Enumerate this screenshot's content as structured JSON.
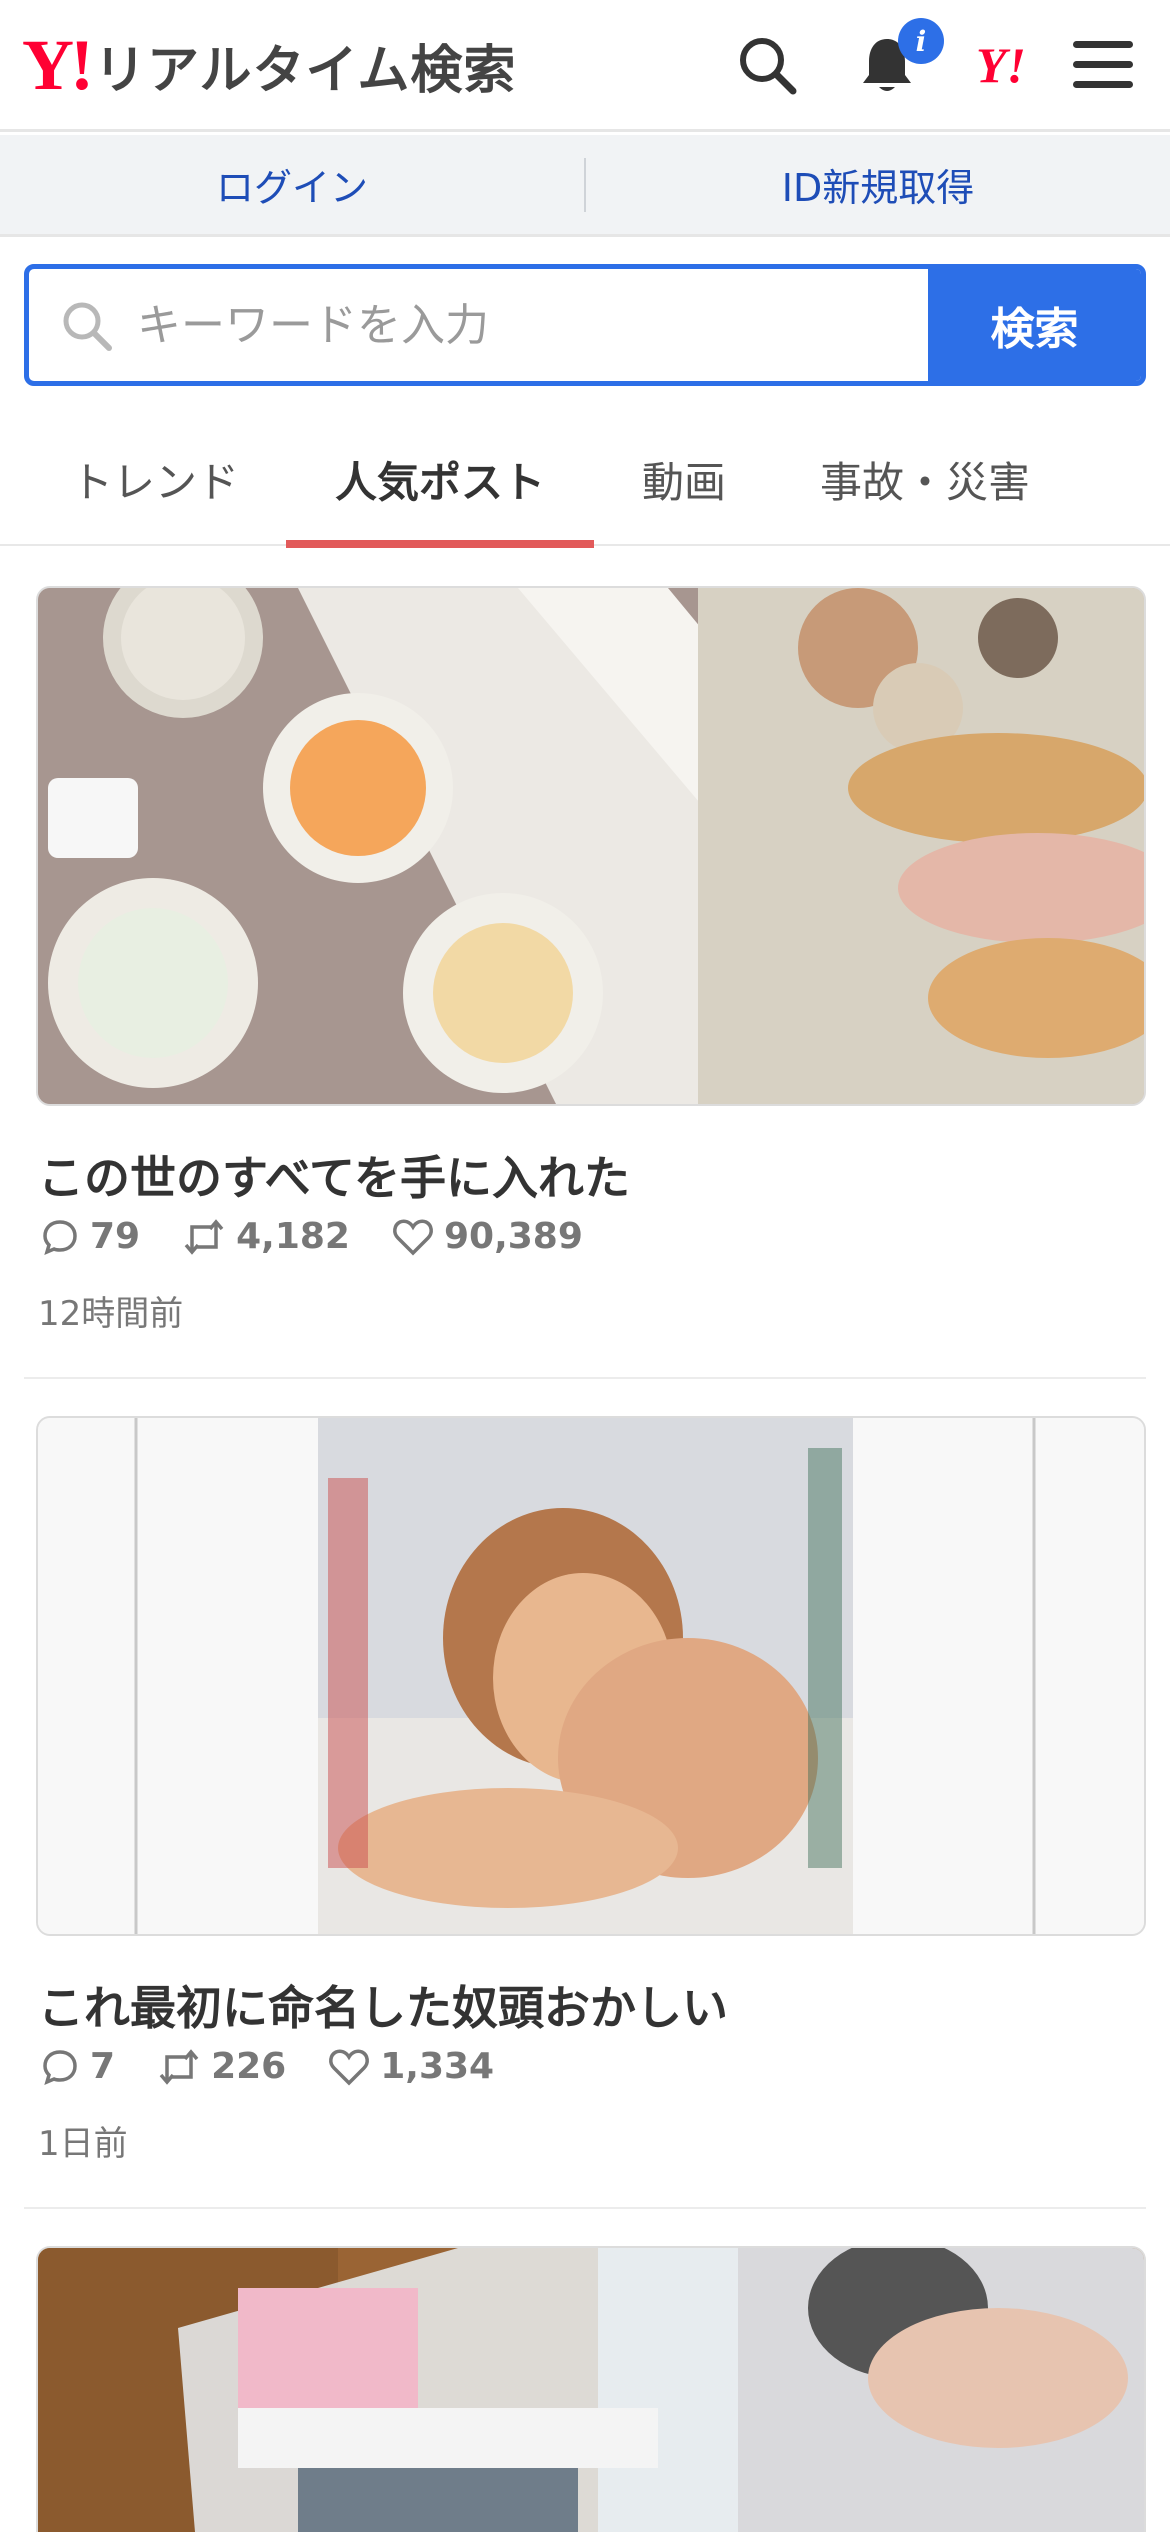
{
  "header": {
    "logo_mark": "Y!",
    "logo_text": "リアルタイム検索",
    "notification_badge": "i",
    "yj_logo": "Y!"
  },
  "login_bar": {
    "login_label": "ログイン",
    "register_label": "ID新規取得"
  },
  "search": {
    "placeholder": "キーワードを入力",
    "button_label": "検索"
  },
  "tabs": [
    {
      "label": "トレンド",
      "active": false
    },
    {
      "label": "人気ポスト",
      "active": true
    },
    {
      "label": "動画",
      "active": false
    },
    {
      "label": "事故・災害",
      "active": false
    }
  ],
  "posts": [
    {
      "title": "この世のすべてを手に入れた",
      "replies": "79",
      "reposts": "4,182",
      "likes": "90,389",
      "time": "12時間前",
      "image": "photo of ice cream cups and donuts in boxes"
    },
    {
      "title": "これ最初に命名した奴頭おかしい",
      "replies": "7",
      "reposts": "226",
      "likes": "1,334",
      "time": "1日前",
      "image": "magazine cover photo"
    },
    {
      "image": "photo of a hand holding a wrapped bottle"
    }
  ],
  "colors": {
    "accent_blue": "#2d6fe7",
    "brand_red": "#ff0033",
    "tab_underline": "#e25a5a",
    "link_blue": "#1e4db7"
  }
}
